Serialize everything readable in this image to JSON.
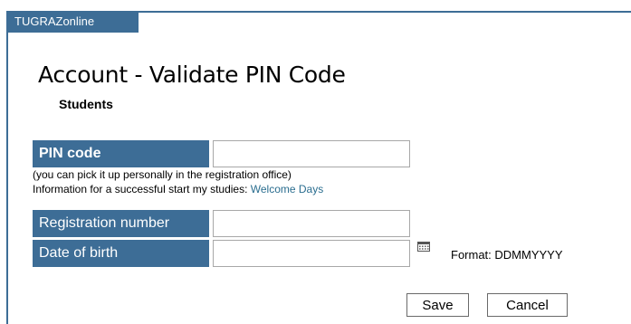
{
  "header": {
    "tab_label": "TUGRAZonline"
  },
  "page": {
    "title": "Account - Validate PIN Code",
    "subtitle": "Students"
  },
  "form": {
    "pin": {
      "label": "PIN code",
      "value": ""
    },
    "pin_note": "(you can pick it up personally in the registration office)",
    "info_text": "Information for a successful start my studies: ",
    "info_link": "Welcome Days",
    "registration": {
      "label": "Registration number",
      "value": ""
    },
    "birth": {
      "label": "Date of birth",
      "value": "",
      "format": "Format: DDMMYYYY"
    }
  },
  "buttons": {
    "save": "Save",
    "cancel": "Cancel"
  },
  "colors": {
    "accent": "#3d6d96",
    "link": "#2a6d8f"
  },
  "icons": {
    "date_picker": "calendar-icon"
  }
}
